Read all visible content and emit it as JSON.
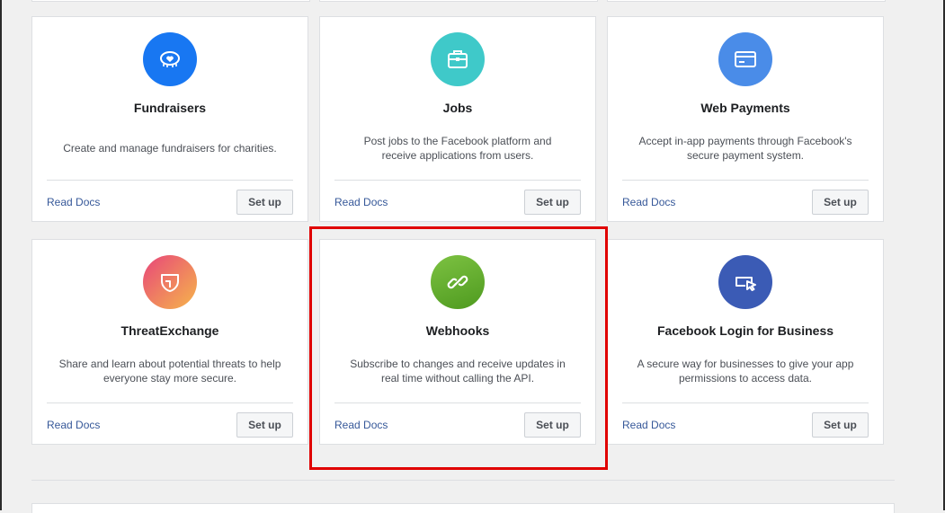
{
  "cards": [
    {
      "title": "Fundraisers",
      "desc": "Create and manage fundraisers for charities.",
      "read_docs": "Read Docs",
      "setup": "Set up",
      "icon": "fundraiser-heart-icon",
      "color": "#1877f2"
    },
    {
      "title": "Jobs",
      "desc": "Post jobs to the Facebook platform and receive applications from users.",
      "read_docs": "Read Docs",
      "setup": "Set up",
      "icon": "briefcase-icon",
      "color": "#3fc9c9"
    },
    {
      "title": "Web Payments",
      "desc": "Accept in-app payments through Facebook's secure payment system.",
      "read_docs": "Read Docs",
      "setup": "Set up",
      "icon": "credit-card-icon",
      "color": "#4a8ce8"
    },
    {
      "title": "ThreatExchange",
      "desc": "Share and learn about potential threats to help everyone stay more secure.",
      "read_docs": "Read Docs",
      "setup": "Set up",
      "icon": "shield-icon",
      "color": "#e84d8a"
    },
    {
      "title": "Webhooks",
      "desc": "Subscribe to changes and receive updates in real time without calling the API.",
      "read_docs": "Read Docs",
      "setup": "Set up",
      "icon": "link-icon",
      "color": "#63b12c"
    },
    {
      "title": "Facebook Login for Business",
      "desc": "A secure way for businesses to give your app permissions to access data.",
      "read_docs": "Read Docs",
      "setup": "Set up",
      "icon": "login-cursor-icon",
      "color": "#3b5bb5"
    }
  ],
  "colors": {
    "highlight": "#e00000",
    "link": "#365899"
  }
}
